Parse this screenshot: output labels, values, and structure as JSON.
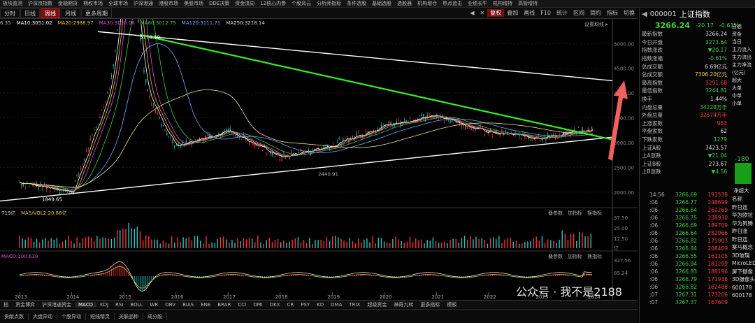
{
  "topmenu": [
    "板块监测",
    "沪深京指数",
    "金融期货",
    "期权市场",
    "全球市场",
    "沪深港通",
    "港股市场",
    "美股市场",
    "DDE决策",
    "资金流向",
    "12核心内参",
    "个股风云",
    "分析师指标",
    "条件选股",
    "基础选股",
    "选股器",
    "机构增仓",
    "热点追击",
    "业绩长牛",
    "机构增持",
    "高管增持"
  ],
  "toolbar": {
    "left": [
      "分时",
      "日线",
      "周线",
      "月线",
      "更多周期"
    ],
    "active": "周线",
    "right": [
      "复权",
      "叠加",
      "画线",
      "F10",
      "统计",
      "区间",
      "简约",
      "指标",
      "切换"
    ],
    "right_active": "复权"
  },
  "ma_bar": {
    "first": "6.35",
    "ma10": "MA10:3051.02",
    "ma20": "MA20:2988.97",
    "ma30": "MA30:3020.06",
    "ma60": "MA60:3012.75",
    "ma120": "MA120:3111.71",
    "ma250": "MA250:3218.14"
  },
  "chart_data": {
    "type": "line",
    "xlabel": "",
    "ylabel": "",
    "x_ticks": [
      "2013",
      "2014",
      "2015",
      "2016",
      "2017",
      "2018",
      "2019",
      "2020",
      "2021",
      "2022",
      "2023",
      "2024"
    ],
    "y_ticks": [
      2000,
      2500,
      3000,
      3500,
      4000,
      4500,
      5000
    ],
    "ylim": [
      1800,
      5300
    ],
    "annotations": {
      "high": "5178.19",
      "low": "1849.65",
      "low2": "2440.91",
      "settings": "设置均线 ▸"
    },
    "series": [
      {
        "x": [
          "2013",
          "2014",
          "2015",
          "2016",
          "2017",
          "2018",
          "2019",
          "2020",
          "2021",
          "2022",
          "2023",
          "2024"
        ],
        "values": [
          2200,
          2000,
          4800,
          2900,
          3250,
          2700,
          2950,
          3350,
          3550,
          3200,
          3100,
          3266
        ]
      }
    ]
  },
  "volume": {
    "label": "719亿",
    "ma": "MA5/VOL2:20.86亿",
    "btns": [
      "叠参数",
      "加指标",
      "换指标"
    ],
    "ticks": [
      "37.50",
      "25.00",
      "12.50"
    ],
    "unit": "亿"
  },
  "macd": {
    "label": "MACD:100.619",
    "btns": [
      "叠参数",
      "加指标",
      "换指标"
    ],
    "ticks": [
      "327.56",
      "85.24"
    ]
  },
  "bottomtabs": [
    "指",
    "资金博弈",
    "沪深港通资金",
    "MACD",
    "KDJ",
    "RSI",
    "BOLL",
    "WR",
    "OBV",
    "BIAS",
    "ENE",
    "BRAR",
    "CCI",
    "DMI",
    "DKX",
    "CR",
    "PSY",
    "KD",
    "DMA",
    "TRIX",
    "超级资金",
    "神奇九转",
    "更多指标",
    "模板"
  ],
  "bottomtabs_active": "MACD",
  "bottomtabs2": [
    "贡献点数",
    "大盘异动",
    "个股异动",
    "短线精灵",
    "关联品种",
    "成分股"
  ],
  "quote": {
    "code": "000001",
    "name": "上证指数",
    "price": "3266.24",
    "change": "-20.17",
    "pct": "-0.61%",
    "rows": [
      {
        "l": "最新指数",
        "v": "3266.24",
        "c": "wht"
      },
      {
        "l": "今日开盘",
        "v": "3273.64",
        "c": "grn"
      },
      {
        "l": "指数涨跌",
        "v": "▼20.17",
        "c": "grn"
      },
      {
        "l": "指数涨幅",
        "v": "-0.61%",
        "c": "grn"
      },
      {
        "l": "总成交额",
        "v": "6.69亿元",
        "c": "wht"
      },
      {
        "l": "总成交额",
        "v": "7306.20亿元",
        "c": "yel"
      },
      {
        "l": "最高指数",
        "v": "3291.68",
        "c": "red"
      },
      {
        "l": "最低指数",
        "v": "3244.81",
        "c": "grn"
      },
      {
        "l": "换手",
        "v": "1.44%",
        "c": "wht"
      },
      {
        "l": "内盘总量",
        "v": "34228万手",
        "c": "grn"
      },
      {
        "l": "外盘总量",
        "v": "32674万手",
        "c": "red"
      },
      {
        "l": "上涨家数",
        "v": "963",
        "c": "red"
      },
      {
        "l": "平盘家数",
        "v": "62",
        "c": "wht"
      },
      {
        "l": "下跌家数",
        "v": "1279",
        "c": "grn"
      },
      {
        "l": "上证A股",
        "v": "3423.57",
        "c": "wht"
      },
      {
        "l": "上A涨跌",
        "v": "▼21.04",
        "c": "grn"
      },
      {
        "l": "上证B股",
        "v": "273.67",
        "c": "wht"
      },
      {
        "l": "上B涨跌",
        "v": "▼4.56",
        "c": "grn"
      }
    ],
    "ticks": [
      {
        "t": "14:56",
        "p": "3266.69",
        "v": "191538"
      },
      {
        "t": ":06",
        "p": "3266.77",
        "v": "248699"
      },
      {
        "t": ":06",
        "p": "3266.64",
        "v": "262269"
      },
      {
        "t": ":06",
        "p": "3266.75",
        "v": "238930"
      },
      {
        "t": ":06",
        "p": "3266.69",
        "v": "189709"
      },
      {
        "t": ":06",
        "p": "3266.64",
        "v": "282966"
      },
      {
        "t": ":06",
        "p": "3266.82",
        "v": "175907"
      },
      {
        "t": ":06",
        "p": "3266.84",
        "v": "208409"
      },
      {
        "t": ":06",
        "p": "3266.55",
        "v": "161105"
      },
      {
        "t": ":06",
        "p": "3266.94",
        "v": "181299"
      },
      {
        "t": ":06",
        "p": "3266.83",
        "v": "188196"
      },
      {
        "t": ":06",
        "p": "3266.79",
        "v": "171936"
      },
      {
        "t": ":06",
        "p": "3266.82",
        "v": "162488"
      },
      {
        "t": ":07",
        "p": "3267.31",
        "v": "173206"
      },
      {
        "t": ":07",
        "p": "3267.37",
        "v": "167609"
      }
    ],
    "side_btns": [
      "自选",
      "资金",
      "当日",
      "主力流入",
      "主力流出",
      "主力净流",
      "(亿元)",
      "超大",
      "大单",
      "中单",
      "小单"
    ],
    "side_val": "-180",
    "side_label": "净超大",
    "side_list": [
      "名称",
      "昨日连",
      "华为欧拉",
      "华为昇腾",
      "昨日涨",
      "昨日连",
      "赛马概念",
      "3D玻璃",
      "MicroLED",
      "屏下摄像",
      "3D摄像头",
      "600178",
      "600178"
    ]
  },
  "watermark": "公众号 · 我不是2188"
}
